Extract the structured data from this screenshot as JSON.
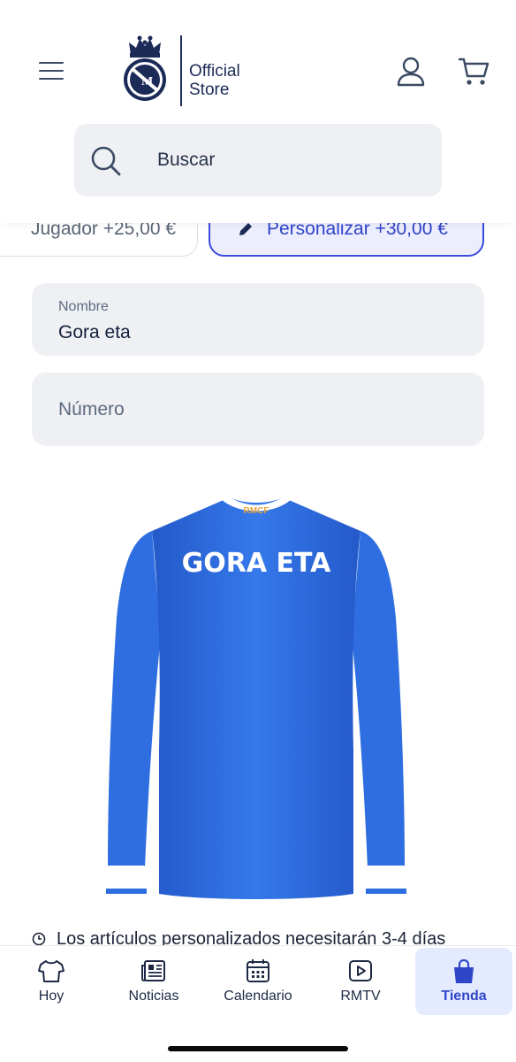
{
  "header": {
    "logo_text_line1": "Official",
    "logo_text_line2": "Store",
    "menu_icon": "hamburger-menu-icon",
    "user_icon": "user-icon",
    "cart_icon": "cart-icon"
  },
  "search": {
    "placeholder": "Buscar",
    "icon": "search-icon"
  },
  "options": {
    "player_label": "Jugador +25,00 €",
    "custom_label": "Personalizar +30,00 €"
  },
  "form": {
    "name_label": "Nombre",
    "name_value": "Gora eta",
    "number_placeholder": "Número"
  },
  "product": {
    "collar_text": "RMCF",
    "printed_name": "GORA ETA",
    "jersey_color": "#2e6ee0"
  },
  "notice": {
    "text": "Los artículos personalizados necesitarán 3-4 días"
  },
  "bottom_nav": {
    "items": [
      {
        "label": "Hoy",
        "icon": "shirt-icon"
      },
      {
        "label": "Noticias",
        "icon": "news-icon"
      },
      {
        "label": "Calendario",
        "icon": "calendar-icon"
      },
      {
        "label": "RMTV",
        "icon": "play-icon"
      },
      {
        "label": "Tienda",
        "icon": "shopping-bag-icon",
        "active": true
      }
    ]
  },
  "colors": {
    "accent": "#3043c9",
    "accent_bg": "#e4ebff",
    "field_bg": "#eef0f4",
    "brand_navy": "#1b2a57"
  }
}
